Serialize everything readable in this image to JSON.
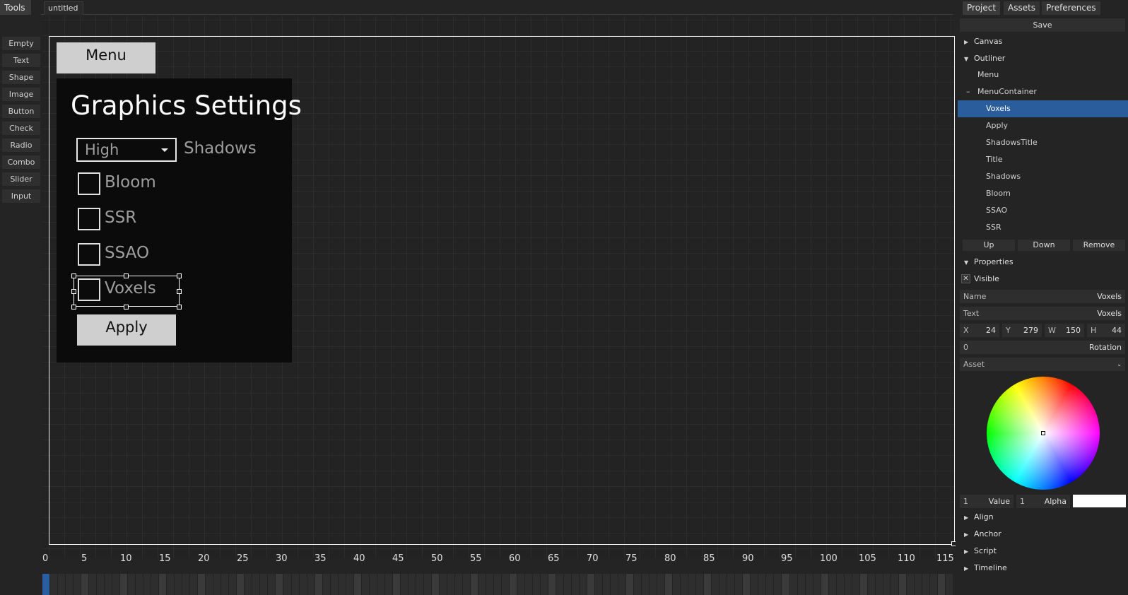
{
  "left_tab": "Tools",
  "file_tab": "untitled",
  "tools": [
    "Empty",
    "Text",
    "Shape",
    "Image",
    "Button",
    "Check",
    "Radio",
    "Combo",
    "Slider",
    "Input"
  ],
  "canvas": {
    "menu_button": "Menu",
    "title": "Graphics Settings",
    "combo_value": "High",
    "combo_label": "Shadows",
    "checks": [
      "Bloom",
      "SSR",
      "SSAO",
      "Voxels"
    ],
    "apply_button": "Apply"
  },
  "ruler_labels": [
    "0",
    "5",
    "10",
    "15",
    "20",
    "25",
    "30",
    "35",
    "40",
    "45",
    "50",
    "55",
    "60",
    "65",
    "70",
    "75",
    "80",
    "85",
    "90",
    "95",
    "100",
    "105",
    "110",
    "115"
  ],
  "right_tabs": [
    "Project",
    "Assets",
    "Preferences"
  ],
  "save_label": "Save",
  "sections": {
    "canvas": "Canvas",
    "outliner": "Outliner",
    "properties": "Properties",
    "align": "Align",
    "anchor": "Anchor",
    "script": "Script",
    "timeline": "Timeline"
  },
  "outline_items": [
    "Menu",
    "MenuContainer",
    "Voxels",
    "Apply",
    "ShadowsTitle",
    "Title",
    "Shadows",
    "Bloom",
    "SSAO",
    "SSR"
  ],
  "outline_selected": "Voxels",
  "outline_buttons": [
    "Up",
    "Down",
    "Remove"
  ],
  "properties": {
    "visible_label": "Visible",
    "visible_mark": "✕",
    "name_label": "Name",
    "name_value": "Voxels",
    "text_label": "Text",
    "text_value": "Voxels",
    "x_label": "X",
    "x_value": "24",
    "y_label": "Y",
    "y_value": "279",
    "w_label": "W",
    "w_value": "150",
    "h_label": "H",
    "h_value": "44",
    "rotation_value": "0",
    "rotation_label": "Rotation",
    "asset_label": "Asset",
    "value_num": "1",
    "value_label": "Value",
    "alpha_num": "1",
    "alpha_label": "Alpha",
    "swatch_color": "#ffffff"
  },
  "colors": {
    "selection": "#2a5d9c",
    "timeline_start": "#2b5e9e"
  }
}
